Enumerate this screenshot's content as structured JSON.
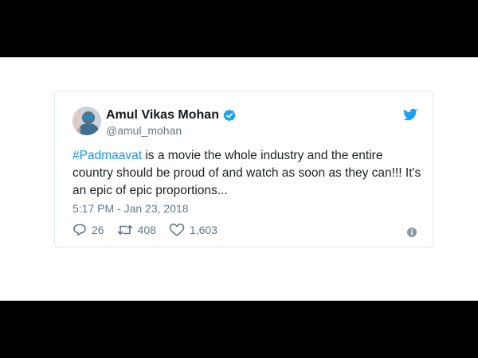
{
  "tweet": {
    "display_name": "Amul Vikas Mohan",
    "handle": "@amul_mohan",
    "hashtag": "#Padmaavat",
    "text_body": " is a movie the whole industry and the entire country should be proud of and watch as soon as they can!!! It's an epic of epic proportions...",
    "timestamp": "5:17 PM - Jan 23, 2018",
    "replies": "26",
    "retweets": "408",
    "likes": "1,603"
  },
  "colors": {
    "brand": "#1da1f2",
    "hashtag": "#1b95e0",
    "secondary_text": "#657786"
  },
  "icons": [
    "verified-badge-icon",
    "twitter-bird-icon",
    "reply-icon",
    "retweet-icon",
    "like-icon",
    "info-icon"
  ]
}
